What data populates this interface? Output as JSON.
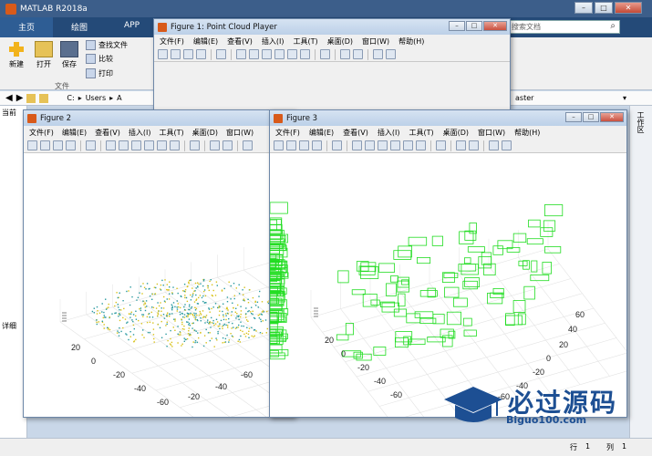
{
  "app": {
    "title": "MATLAB R2018a"
  },
  "tabs": [
    {
      "label": "主页"
    },
    {
      "label": "绘图"
    },
    {
      "label": "APP"
    }
  ],
  "ribbon": {
    "new_label": "新建",
    "open_label": "打开",
    "save_label": "保存",
    "find_files_label": "查找文件",
    "compare_label": "比较",
    "print_label": "打印",
    "file_section_label": "文件",
    "search_placeholder": "搜索文档"
  },
  "address": {
    "path_parts": [
      "C:",
      "Users",
      "A"
    ],
    "right_text": "aster"
  },
  "left_panel": {
    "current_folder_label": "当前",
    "details_label": "详细"
  },
  "right_strip": {
    "label": "工作区"
  },
  "status": {
    "row_label": "行",
    "row_value": "1",
    "col_label": "列",
    "col_value": "1"
  },
  "figure_menu": [
    "文件(F)",
    "编辑(E)",
    "查看(V)",
    "插入(I)",
    "工具(T)",
    "桌面(D)",
    "窗口(W)",
    "帮助(H)"
  ],
  "fig1": {
    "title": "Figure 1: Point Cloud Player"
  },
  "fig2": {
    "title": "Figure 2",
    "x_ticks": [
      "20",
      "0",
      "-20",
      "-40",
      "-60"
    ],
    "y_ticks": [
      "-20",
      "-40",
      "-60"
    ]
  },
  "fig3": {
    "title": "Figure 3",
    "x_ticks": [
      "20",
      "0",
      "-20",
      "-40",
      "-60"
    ],
    "y_ticks": [
      "60",
      "40",
      "20",
      "0",
      "-20",
      "-40",
      "-60"
    ]
  },
  "watermark": {
    "brand": "必过源码",
    "url": "Biguo100.com"
  },
  "colors": {
    "matlab_blue": "#244a78",
    "pointcloud_yellow": "#d8c21a",
    "pointcloud_teal": "#2a9aa0",
    "boxes_green": "#22dd22"
  }
}
